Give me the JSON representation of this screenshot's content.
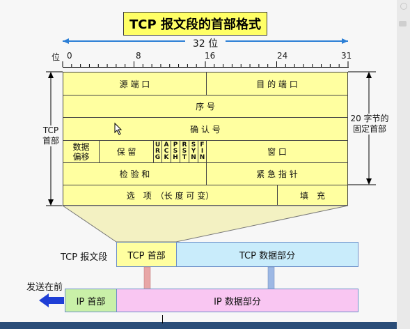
{
  "title": "TCP 报文段的首部格式",
  "bit_width": "32 位",
  "ruler": {
    "label": "位",
    "ticks": [
      "0",
      "8",
      "16",
      "24",
      "31"
    ]
  },
  "header_fields": {
    "source_port": "源 端 口",
    "dest_port": "目 的 端 口",
    "seq": "序 号",
    "ack": "确 认 号",
    "data_offset": [
      "数据",
      "偏移"
    ],
    "reserved": "保 留",
    "flags": [
      [
        "U",
        "R",
        "G"
      ],
      [
        "A",
        "C",
        "K"
      ],
      [
        "P",
        "S",
        "H"
      ],
      [
        "R",
        "S",
        "T"
      ],
      [
        "S",
        "Y",
        "N"
      ],
      [
        "F",
        "I",
        "N"
      ]
    ],
    "window": "窗 口",
    "checksum": "检 验 和",
    "urgent_pointer": "紧 急 指 针",
    "options": "选　项　（长 度 可 变）",
    "padding": "填　充"
  },
  "left_brace_label": [
    "TCP",
    "首部"
  ],
  "right_brace_label": [
    "20 字节的",
    "固定首部"
  ],
  "segment": {
    "row_label": "TCP 报文段",
    "header": "TCP 首部",
    "data": "TCP 数据部分"
  },
  "ip_packet": {
    "send_first": "发送在前",
    "header": "IP 首部",
    "data": "IP 数据部分"
  },
  "colors": {
    "title_bg": "#ffff66",
    "table_bg": "#ffffa0",
    "tcp_header_bg": "#ffffa0",
    "tcp_data_bg": "#c9ecfb",
    "ip_header_bg": "#c9f0a8",
    "ip_data_bg": "#f9c6f2",
    "arrow_pink": "#e8a6a6",
    "arrow_blue": "#9db8e4",
    "send_arrow": "#1f3fd6"
  }
}
